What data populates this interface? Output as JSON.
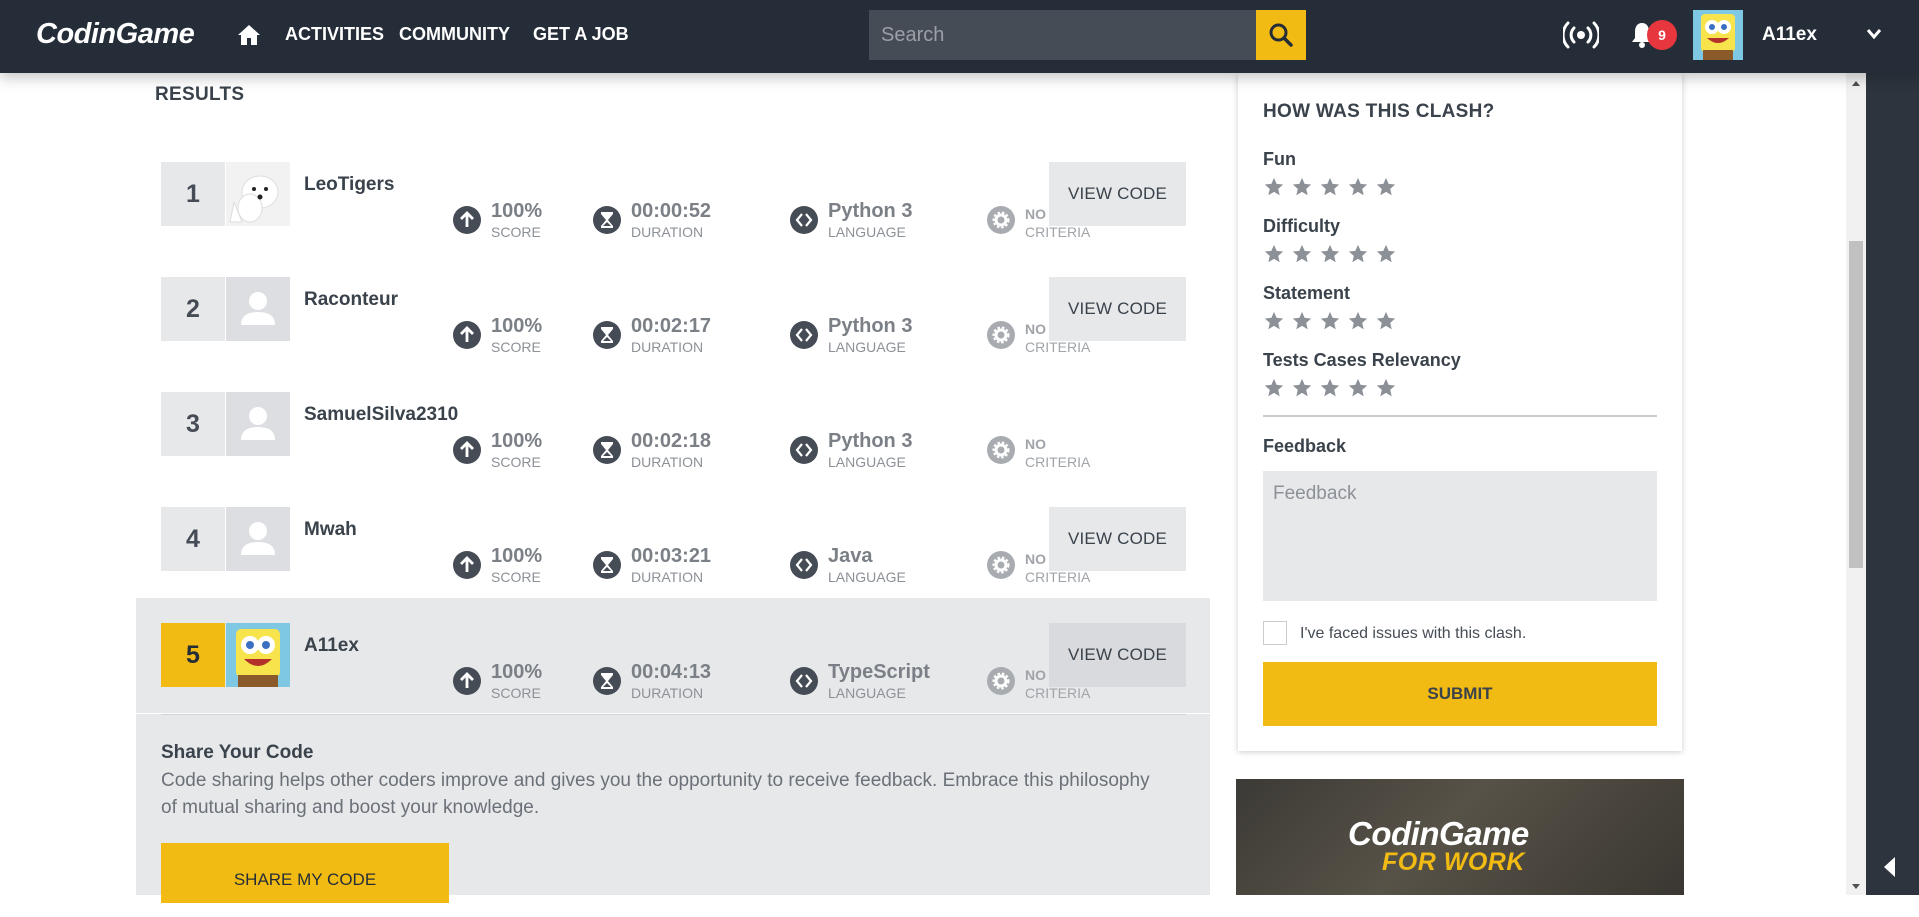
{
  "nav": {
    "logo": "CodinGame",
    "items": [
      "ACTIVITIES",
      "COMMUNITY",
      "GET A JOB"
    ],
    "search_placeholder": "Search",
    "notifications": "9",
    "username": "A11ex"
  },
  "results": {
    "title": "RESULTS",
    "score_label": "SCORE",
    "duration_label": "DURATION",
    "language_label": "LANGUAGE",
    "criteria_value": "NO",
    "criteria_label": "CRITERIA",
    "view_code": "VIEW CODE",
    "rows": [
      {
        "rank": "1",
        "name": "LeoTigers",
        "score": "100%",
        "duration": "00:00:52",
        "language": "Python 3",
        "avatar": "dog"
      },
      {
        "rank": "2",
        "name": "Raconteur",
        "score": "100%",
        "duration": "00:02:17",
        "language": "Python 3",
        "avatar": "default"
      },
      {
        "rank": "3",
        "name": "SamuelSilva2310",
        "score": "100%",
        "duration": "00:02:18",
        "language": "Python 3",
        "avatar": "default"
      },
      {
        "rank": "4",
        "name": "Mwah",
        "score": "100%",
        "duration": "00:03:21",
        "language": "Java",
        "avatar": "default"
      },
      {
        "rank": "5",
        "name": "A11ex",
        "score": "100%",
        "duration": "00:04:13",
        "language": "TypeScript",
        "avatar": "sponge"
      }
    ]
  },
  "share": {
    "title": "Share Your Code",
    "text": "Code sharing helps other coders improve and gives you the opportunity to receive feedback. Embrace this philosophy of mutual sharing and boost your knowledge.",
    "button": "SHARE MY CODE"
  },
  "feedback": {
    "title": "HOW WAS THIS CLASH?",
    "ratings": [
      "Fun",
      "Difficulty",
      "Statement",
      "Tests Cases Relevancy"
    ],
    "stars_per_rating": 5,
    "feedback_label": "Feedback",
    "feedback_placeholder": "Feedback",
    "issue_label": "I've faced issues with this clash.",
    "submit": "SUBMIT"
  },
  "promo": {
    "logo": "CodinGame",
    "sub": "FOR WORK"
  },
  "colors": {
    "brand_yellow": "#f2bb13",
    "nav_bg": "#252e38",
    "badge_red": "#e7363d"
  }
}
